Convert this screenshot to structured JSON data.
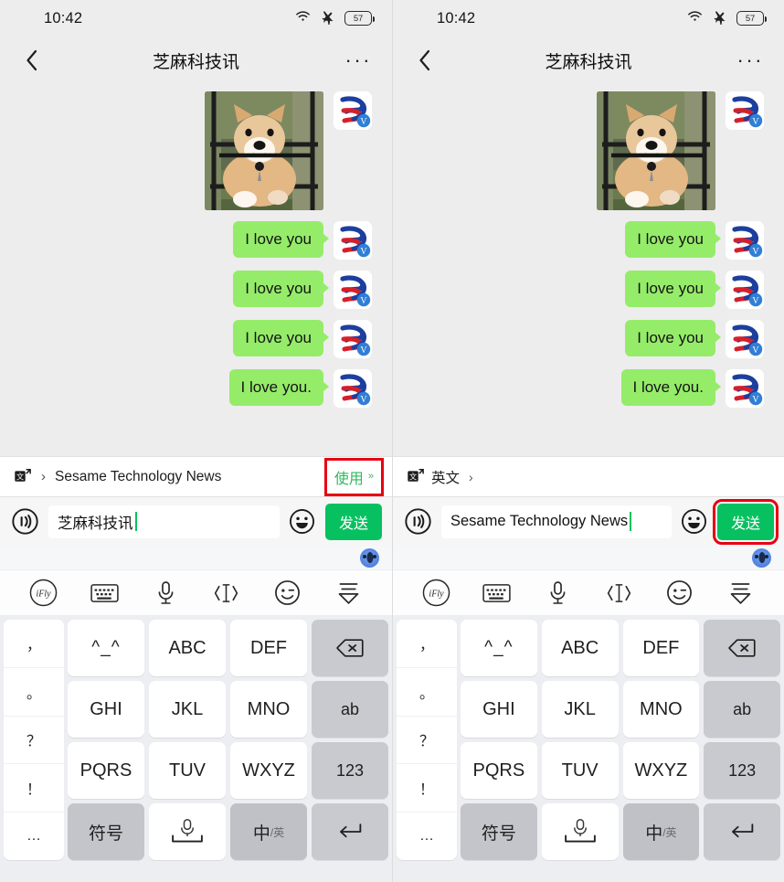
{
  "status": {
    "time": "10:42",
    "wifi_icon": "wifi-icon",
    "airplane_icon": "airplane-mode-icon",
    "battery": "57"
  },
  "nav": {
    "back_icon": "back-chevron-icon",
    "title": "芝麻科技讯",
    "more_icon": "more-options-icon",
    "more_label": "···"
  },
  "chat": {
    "photo_alt": "shiba-inu-photo",
    "messages": [
      {
        "type": "image",
        "label": "shiba-inu-photo"
      },
      {
        "type": "text",
        "text": "I love you"
      },
      {
        "type": "text",
        "text": "I love you"
      },
      {
        "type": "text",
        "text": "I love you"
      },
      {
        "type": "text",
        "text": "I love you."
      }
    ]
  },
  "left_panel": {
    "translate_bar": {
      "translate_icon": "translate-icon",
      "chevron": "›",
      "source_text": "Sesame Technology News",
      "use_label": "使用",
      "use_chevron": "»",
      "highlighted": true
    },
    "input": {
      "voice_icon": "voice-input-icon",
      "value": "芝麻科技讯",
      "emoji_icon": "emoji-icon",
      "send_label": "发送",
      "send_highlighted": false
    }
  },
  "right_panel": {
    "translate_bar": {
      "translate_icon": "translate-icon",
      "lang_label": "英文",
      "lang_chevron": "›"
    },
    "input": {
      "voice_icon": "voice-input-icon",
      "value": "Sesame Technology News",
      "emoji_icon": "emoji-icon",
      "send_label": "发送",
      "send_highlighted": true
    }
  },
  "keyboard": {
    "mascot_icon": "ime-mascot-icon",
    "toolbar": [
      {
        "name": "ime-logo-icon",
        "label": "iFly"
      },
      {
        "name": "keyboard-icon",
        "label": ""
      },
      {
        "name": "microphone-icon",
        "label": ""
      },
      {
        "name": "cursor-move-icon",
        "label": ""
      },
      {
        "name": "emoticon-icon",
        "label": ""
      },
      {
        "name": "collapse-keyboard-icon",
        "label": ""
      }
    ],
    "punctuation": [
      "，",
      "。",
      "？",
      "！",
      "…"
    ],
    "keys": [
      {
        "label": "^_^",
        "style": "emo"
      },
      {
        "label": "ABC",
        "style": ""
      },
      {
        "label": "DEF",
        "style": ""
      },
      {
        "label": "⌫",
        "style": "fn",
        "name": "backspace-key"
      },
      {
        "label": "GHI",
        "style": ""
      },
      {
        "label": "JKL",
        "style": ""
      },
      {
        "label": "MNO",
        "style": ""
      },
      {
        "label": "ab",
        "style": "fn",
        "name": "ab-key"
      },
      {
        "label": "PQRS",
        "style": ""
      },
      {
        "label": "TUV",
        "style": ""
      },
      {
        "label": "WXYZ",
        "style": ""
      },
      {
        "label": "123",
        "style": "fn",
        "name": "numeric-key"
      },
      {
        "label": "符号",
        "style": "fn2",
        "name": "symbols-key"
      },
      {
        "label": "␣",
        "style": "",
        "name": "space-key"
      },
      {
        "label": "中",
        "sub": "/英",
        "style": "fn3",
        "name": "language-toggle-key"
      },
      {
        "label": "↵",
        "style": "fn",
        "name": "enter-key"
      }
    ]
  },
  "colors": {
    "bubble_green": "#95ec69",
    "send_green": "#07c160",
    "use_green": "#2eb85c",
    "highlight_red": "#e60012",
    "chat_bg": "#ededed"
  }
}
